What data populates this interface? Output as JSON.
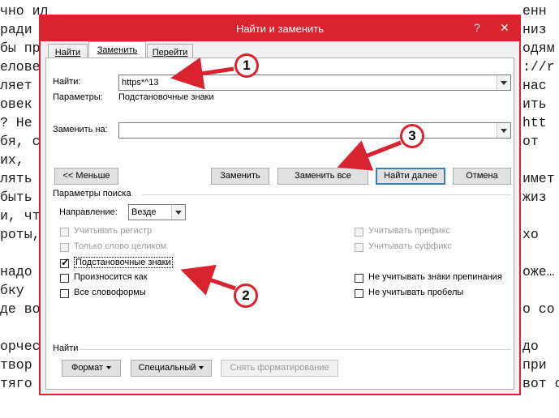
{
  "background_text": [
    "чно ил",
    "ради",
    "бы пр",
    "елове",
    "ляет",
    "овек",
    "? Не",
    "бя, с",
    "их,",
    "лять",
    "быть",
    "и, чт",
    "роты,",
    "надо",
    "бку",
    "де во",
    "орчес",
    "твор",
    "тяго"
  ],
  "background_text_right": [
    "енн",
    "низ",
    "одям",
    "://r",
    "нас",
    "ить",
    "htt",
    "от",
    "",
    "имет",
    "жиз",
    "",
    "хо",
    "оже…",
    "",
    "о со",
    "до",
    "при",
    "вот с"
  ],
  "dialog": {
    "title": "Найти и заменить",
    "help_glyph": "?",
    "close_glyph": "✕"
  },
  "tabs": [
    {
      "label": "Найти"
    },
    {
      "label": "Заменить"
    },
    {
      "label": "Перейти"
    }
  ],
  "find": {
    "label": "Найти:",
    "value": "https*^13",
    "options_label": "Параметры:",
    "options_value": "Подстановочные знаки"
  },
  "replace": {
    "label": "Заменить на:",
    "value": ""
  },
  "buttons": {
    "less": "<< Меньше",
    "replace": "Заменить",
    "replace_all": "Заменить все",
    "find_next": "Найти далее",
    "cancel": "Отмена"
  },
  "search_options": {
    "section_label": "Параметры поиска",
    "direction_label": "Направление:",
    "direction_value": "Везде",
    "left": [
      {
        "label": "Учитывать регистр",
        "checked": false,
        "enabled": false
      },
      {
        "label": "Только слово целиком",
        "checked": false,
        "enabled": false
      },
      {
        "label": "Подстановочные знаки",
        "checked": true,
        "enabled": true
      },
      {
        "label": "Произносится как",
        "checked": false,
        "enabled": true
      },
      {
        "label": "Все словоформы",
        "checked": false,
        "enabled": true
      }
    ],
    "right": [
      {
        "label": "Учитывать префикс",
        "checked": false,
        "enabled": false
      },
      {
        "label": "Учитывать суффикс",
        "checked": false,
        "enabled": false
      },
      {
        "label": "Не учитывать знаки препинания",
        "checked": false,
        "enabled": true
      },
      {
        "label": "Не учитывать пробелы",
        "checked": false,
        "enabled": true
      }
    ]
  },
  "find_section": {
    "label": "Найти",
    "format_button": "Формат",
    "special_button": "Специальный",
    "clear_format_button": "Снять форматирование"
  },
  "annotations": {
    "markers": [
      "1",
      "2",
      "3"
    ],
    "color": "#d9232e"
  }
}
